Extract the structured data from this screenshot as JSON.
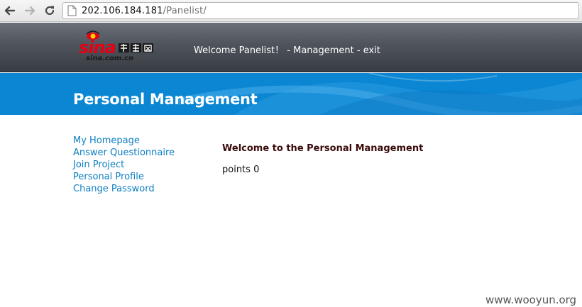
{
  "browser": {
    "url_host": "202.106.184.181",
    "url_path": "/Panelist/",
    "icons": {
      "back": "back-arrow-icon",
      "forward": "forward-arrow-icon",
      "reload": "reload-icon",
      "page": "page-icon"
    }
  },
  "header": {
    "logo": {
      "brand": "sina",
      "chinese": "新浪网",
      "domain": "sina.com.cn",
      "accent_color": "#e60012"
    },
    "welcome_text": "Welcome Panelist！ - ",
    "management_link": "Management",
    "separator": " - ",
    "exit_link": "exit"
  },
  "banner": {
    "title": "Personal Management",
    "color": "#0a86d3"
  },
  "sidebar": {
    "items": [
      {
        "label": "My Homepage"
      },
      {
        "label": "Answer Questionnaire"
      },
      {
        "label": "Join Project"
      },
      {
        "label": "Personal Profile"
      },
      {
        "label": "Change Password"
      }
    ],
    "link_color": "#0d7fc3"
  },
  "main": {
    "heading": "Welcome to the Personal Management",
    "points_label": "points",
    "points_value": "0"
  },
  "watermark": "www.wooyun.org"
}
